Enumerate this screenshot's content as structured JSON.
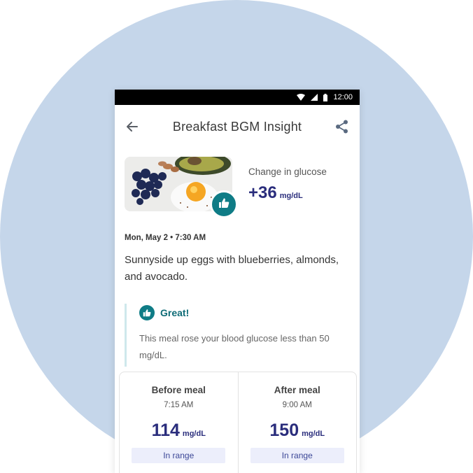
{
  "status_bar": {
    "time": "12:00"
  },
  "app_bar": {
    "title": "Breakfast BGM Insight"
  },
  "meal": {
    "glucose_change_label": "Change in glucose",
    "glucose_change_value": "+36",
    "glucose_change_unit": "mg/dL",
    "date": "Mon, May 2 • 7:30 AM",
    "description": "Sunnyside up eggs with blueberries, almonds, and avocado."
  },
  "callout": {
    "title": "Great!",
    "text": "This meal rose your blood glucose less than 50 mg/dL."
  },
  "before": {
    "title": "Before meal",
    "time": "7:15 AM",
    "value": "114",
    "unit": "mg/dL",
    "status": "In range"
  },
  "after": {
    "title": "After meal",
    "time": "9:00 AM",
    "value": "150",
    "unit": "mg/dL",
    "status": "In range"
  },
  "colors": {
    "accent": "#0f7c86",
    "value": "#2a2d7c",
    "background_circle": "#c5d6ea"
  }
}
